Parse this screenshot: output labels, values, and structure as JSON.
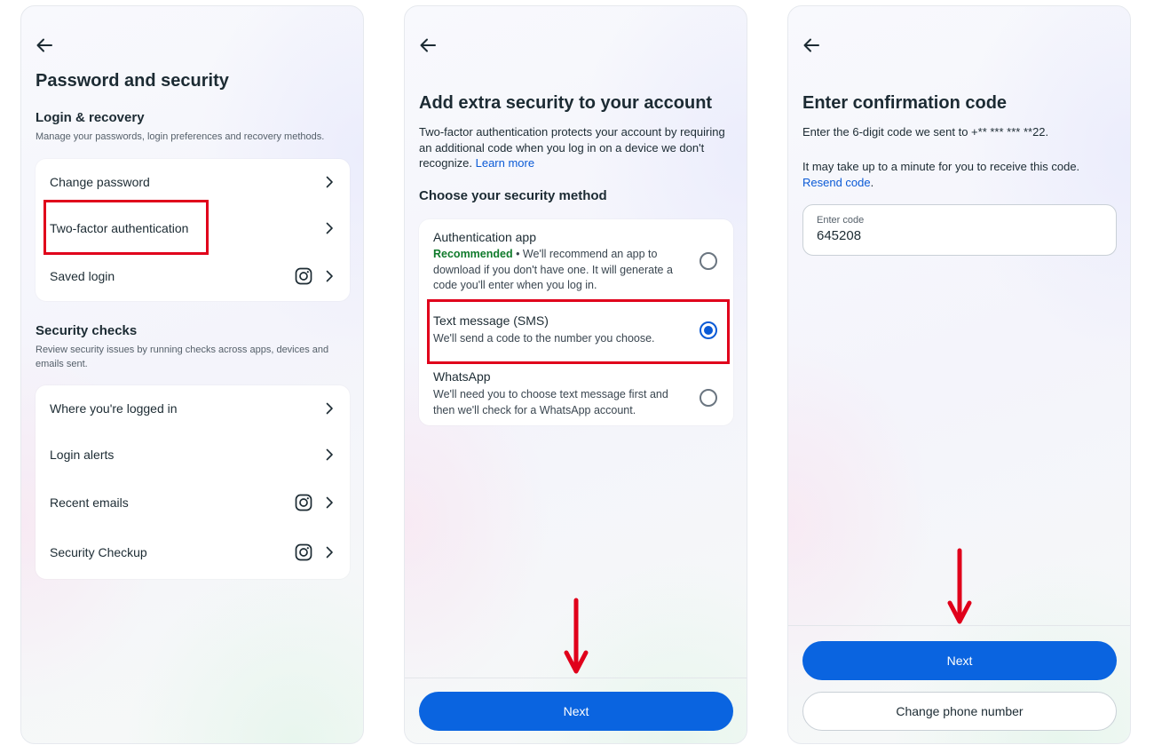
{
  "colors": {
    "primary_button": "#0a64e0",
    "link": "#0a5ad6",
    "recommended": "#0f7a2b",
    "highlight": "#e0001b"
  },
  "panel1": {
    "back_icon": "arrow-left-icon",
    "title": "Password and security",
    "login_recovery": {
      "heading": "Login & recovery",
      "description": "Manage your passwords, login preferences and recovery methods.",
      "items": [
        {
          "label": "Change password",
          "icon": ""
        },
        {
          "label": "Two-factor authentication",
          "icon": ""
        },
        {
          "label": "Saved login",
          "icon": "instagram-icon"
        }
      ]
    },
    "security_checks": {
      "heading": "Security checks",
      "description": "Review security issues by running checks across apps, devices and emails sent.",
      "items": [
        {
          "label": "Where you're logged in",
          "icon": ""
        },
        {
          "label": "Login alerts",
          "icon": ""
        },
        {
          "label": "Recent emails",
          "icon": "instagram-icon"
        },
        {
          "label": "Security Checkup",
          "icon": "instagram-icon"
        }
      ]
    }
  },
  "panel2": {
    "back_icon": "arrow-left-icon",
    "title": "Add extra security to your account",
    "description": "Two-factor authentication protects your account by requiring an additional code when you log in on a device we don't recognize.",
    "learn_more": "Learn more",
    "method_heading": "Choose your security method",
    "options": [
      {
        "title": "Authentication app",
        "badge": "Recommended",
        "description": " • We'll recommend an app to download if you don't have one. It will generate a code you'll enter when you log in.",
        "selected": false
      },
      {
        "title": "Text message (SMS)",
        "badge": "",
        "description": "We'll send a code to the number you choose.",
        "selected": true
      },
      {
        "title": "WhatsApp",
        "badge": "",
        "description": "We'll need you to choose text message first and then we'll check for a WhatsApp account.",
        "selected": false
      }
    ],
    "next_label": "Next"
  },
  "panel3": {
    "back_icon": "arrow-left-icon",
    "title": "Enter confirmation code",
    "line1": "Enter the 6-digit code we sent to +** *** *** **22.",
    "line2": "It may take up to a minute for you to receive this code.",
    "resend_label": "Resend code",
    "resend_suffix": ".",
    "input": {
      "placeholder": "Enter code",
      "value": "645208"
    },
    "next_label": "Next",
    "change_phone_label": "Change phone number"
  }
}
